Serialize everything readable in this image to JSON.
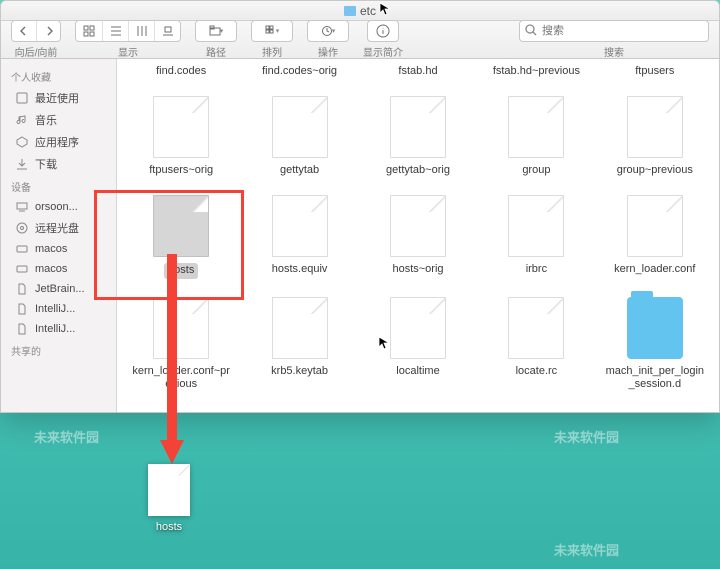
{
  "window": {
    "title": "etc"
  },
  "toolbar": {
    "nav_label": "向后/向前",
    "view_label": "显示",
    "path_label": "路径",
    "arrange_label": "排列",
    "action_label": "操作",
    "info_label": "显示简介",
    "search_placeholder": "搜索",
    "search_label": "搜索"
  },
  "sidebar": {
    "favorites_label": "个人收藏",
    "devices_label": "设备",
    "shared_label": "共享的",
    "favorites": [
      "最近使用",
      "音乐",
      "应用程序",
      "下载"
    ],
    "devices": [
      "orsoon...",
      "远程光盘",
      "macos",
      "macos",
      "JetBrain...",
      "IntelliJ...",
      "IntelliJ..."
    ]
  },
  "files": {
    "row1": [
      "find.codes",
      "find.codes~orig",
      "fstab.hd",
      "fstab.hd~previous",
      "ftpusers"
    ],
    "row2": [
      "ftpusers~orig",
      "gettytab",
      "gettytab~orig",
      "group",
      "group~previous"
    ],
    "row3": [
      "hosts",
      "hosts.equiv",
      "hosts~orig",
      "irbrc",
      "kern_loader.conf"
    ],
    "row4": [
      "kern_loader.conf~previous",
      "krb5.keytab",
      "localtime",
      "locate.rc",
      "mach_init_per_login_session.d"
    ]
  },
  "desktop": {
    "file_name": "hosts"
  },
  "watermark": "未来软件园"
}
